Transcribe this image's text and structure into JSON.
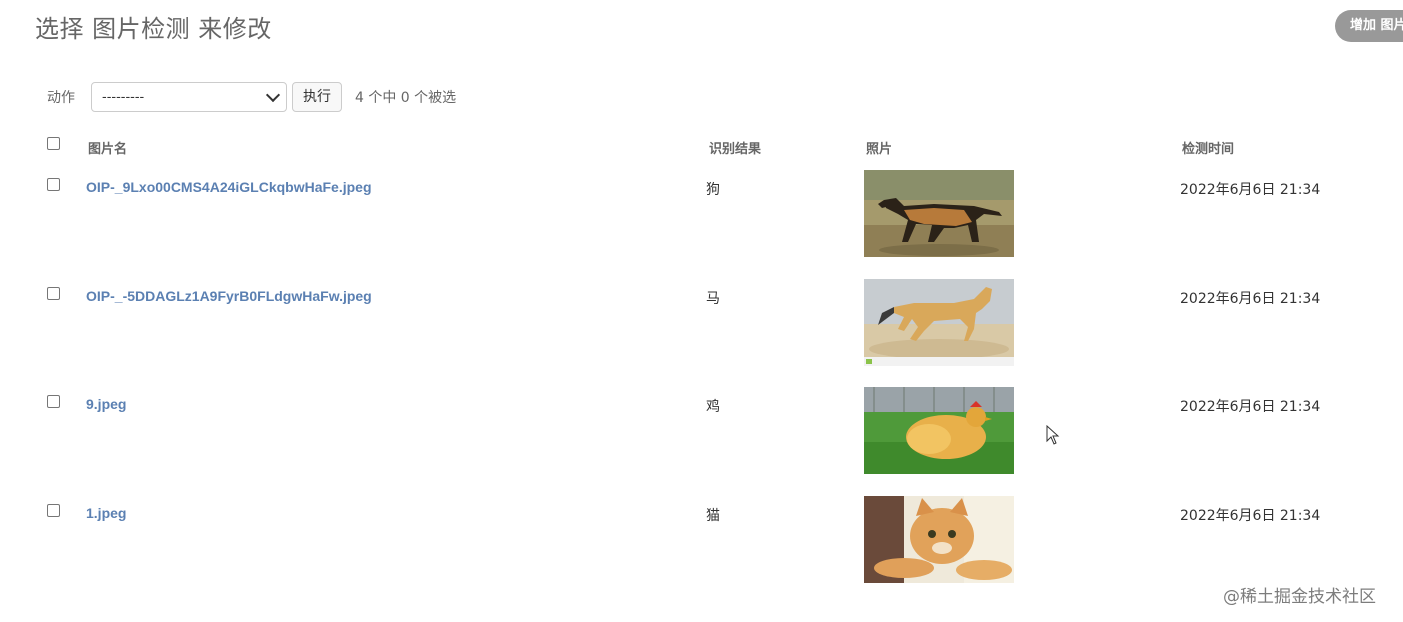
{
  "header": {
    "title": "选择 图片检测 来修改",
    "add_button": "增加 图片检测"
  },
  "actions": {
    "label": "动作",
    "select_value": "---------",
    "run_button": "执行",
    "counter": "4 个中 0 个被选"
  },
  "table": {
    "columns": [
      "图片名",
      "识别结果",
      "照片",
      "检测时间"
    ],
    "rows": [
      {
        "filename": "OIP-_9Lxo00CMS4A24iGLCkqbwHaFe.jpeg",
        "result": "狗",
        "photo": "dog-photo",
        "time": "2022年6月6日 21:34"
      },
      {
        "filename": "OIP-_-5DDAGLz1A9FyrB0FLdgwHaFw.jpeg",
        "result": "马",
        "photo": "horse-photo",
        "time": "2022年6月6日 21:34"
      },
      {
        "filename": "9.jpeg",
        "result": "鸡",
        "photo": "chicken-photo",
        "time": "2022年6月6日 21:34"
      },
      {
        "filename": "1.jpeg",
        "result": "猫",
        "photo": "cat-photo",
        "time": "2022年6月6日 21:34"
      }
    ]
  },
  "watermark": "@稀土掘金技术社区",
  "colors": {
    "link": "#5b80b2",
    "add_button_bg": "#999999"
  }
}
